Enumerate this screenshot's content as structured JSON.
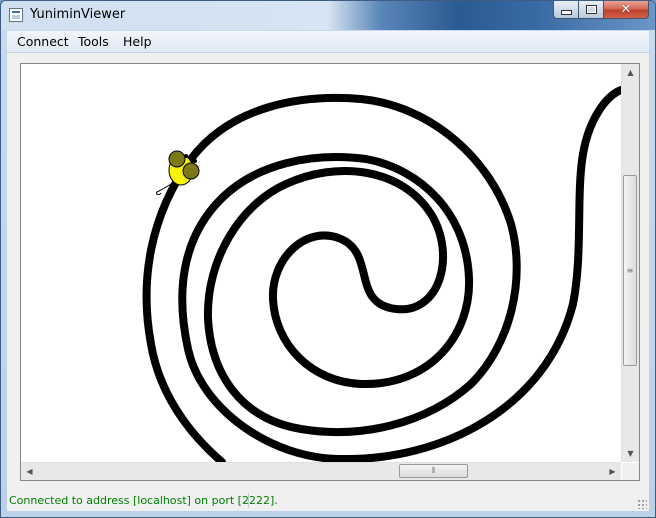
{
  "window": {
    "title": "YuniminViewer"
  },
  "menu": {
    "items": [
      "Connect",
      "Tools",
      "Help"
    ]
  },
  "canvas": {
    "description_icon": "mouse-robot-icon",
    "track_color": "#000000",
    "robot_body_color": "#f7f20c",
    "robot_wheel_color": "#7c7a16"
  },
  "scrollbars": {
    "vertical_glyph": "≡",
    "horizontal_glyph": "⦀",
    "up": "▲",
    "down": "▼",
    "left": "◀",
    "right": "▶"
  },
  "status": {
    "text": "Connected to address [localhost] on port [2222].",
    "color": "#008000"
  }
}
